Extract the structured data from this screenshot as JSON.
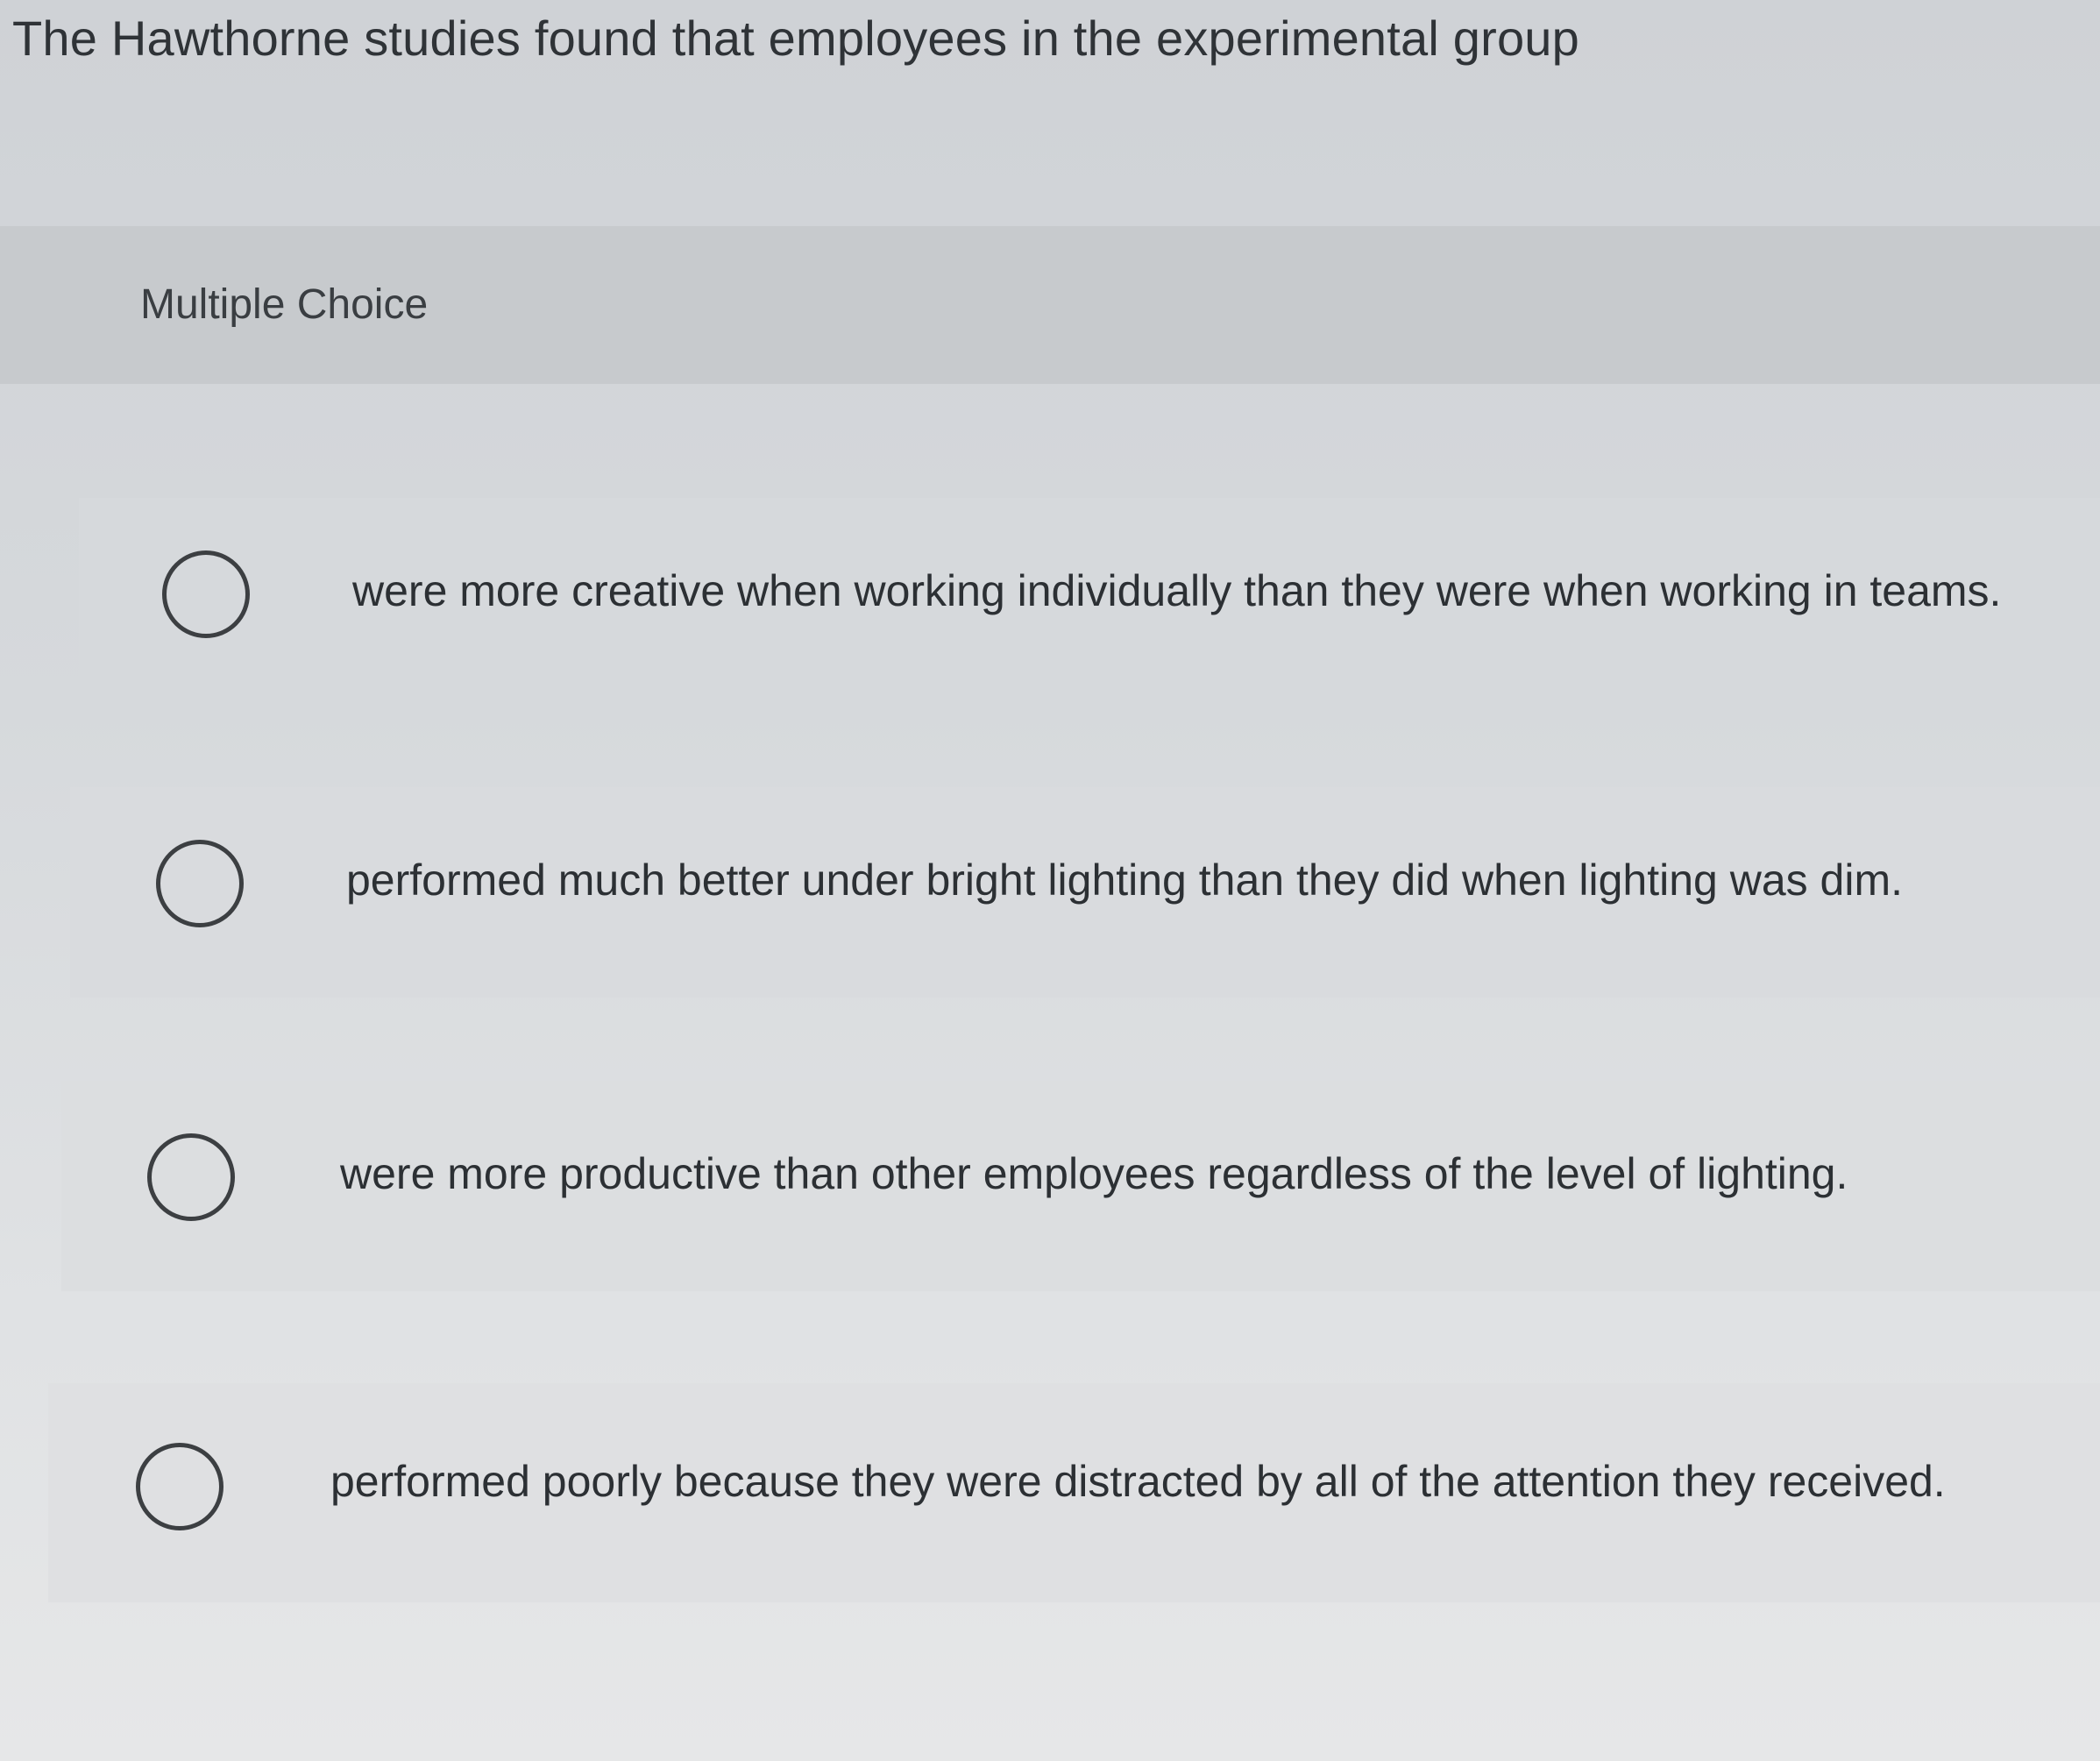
{
  "question": {
    "text": "The Hawthorne studies found that employees in the experimental group"
  },
  "multiple_choice": {
    "label": "Multiple Choice",
    "options": [
      {
        "text": "were more creative when working individually than they were when working in teams.",
        "selected": false
      },
      {
        "text": "performed much better under bright lighting than they did when lighting was dim.",
        "selected": false
      },
      {
        "text": "were more productive than other employees regardless of the level of lighting.",
        "selected": false
      },
      {
        "text": "performed poorly because they were distracted by all of the attention they received.",
        "selected": false
      }
    ]
  }
}
